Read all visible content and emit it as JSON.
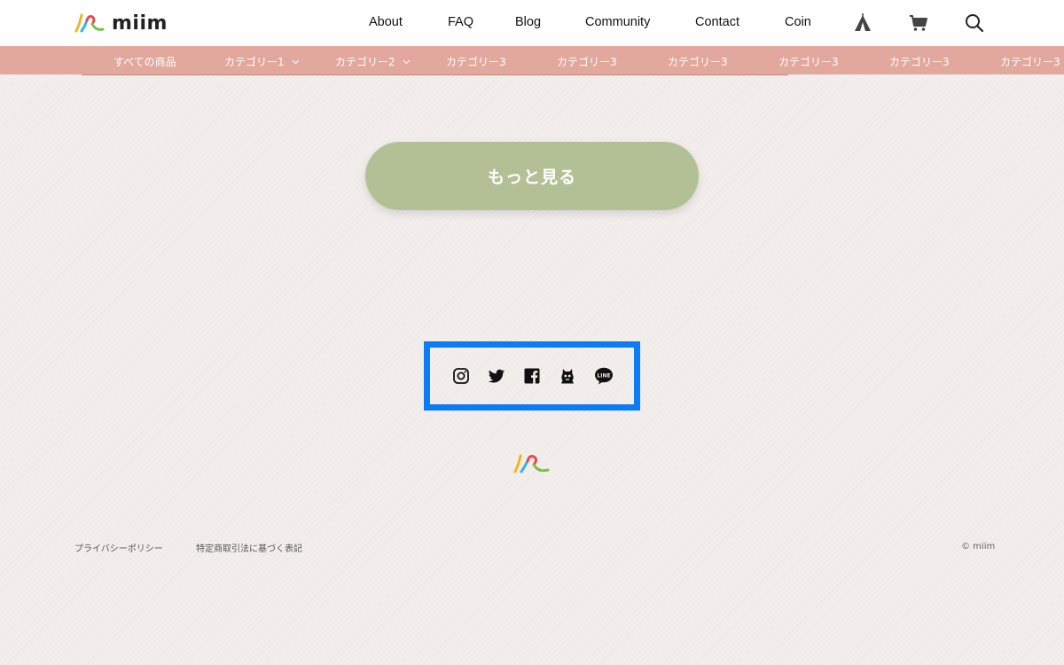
{
  "header": {
    "logo_text": "miim",
    "nav": [
      {
        "label": "About"
      },
      {
        "label": "FAQ"
      },
      {
        "label": "Blog"
      },
      {
        "label": "Community"
      },
      {
        "label": "Contact"
      },
      {
        "label": "Coin"
      }
    ],
    "icons": [
      "tent-icon",
      "cart-icon",
      "search-icon"
    ]
  },
  "categories": [
    {
      "label": "すべての商品",
      "dropdown": false
    },
    {
      "label": "カテゴリー1",
      "dropdown": true
    },
    {
      "label": "カテゴリー2",
      "dropdown": true
    },
    {
      "label": "カテゴリー3",
      "dropdown": false
    },
    {
      "label": "カテゴリー3",
      "dropdown": false
    },
    {
      "label": "カテゴリー3",
      "dropdown": false
    },
    {
      "label": "カテゴリー3",
      "dropdown": false
    },
    {
      "label": "カテゴリー3",
      "dropdown": false
    },
    {
      "label": "カテゴリー3",
      "dropdown": false
    }
  ],
  "main": {
    "more_label": "もっと見る"
  },
  "social": [
    "instagram-icon",
    "twitter-icon",
    "facebook-icon",
    "ghost-icon",
    "line-icon"
  ],
  "footer": {
    "links": [
      {
        "label": "プライバシーポリシー"
      },
      {
        "label": "特定商取引法に基づく表記"
      }
    ],
    "copyright": "© miim"
  },
  "colors": {
    "accent_bar": "#e2a89e",
    "more_button": "#b3c095",
    "highlight_frame": "#0a7cf5",
    "background": "#f0ebe9"
  }
}
